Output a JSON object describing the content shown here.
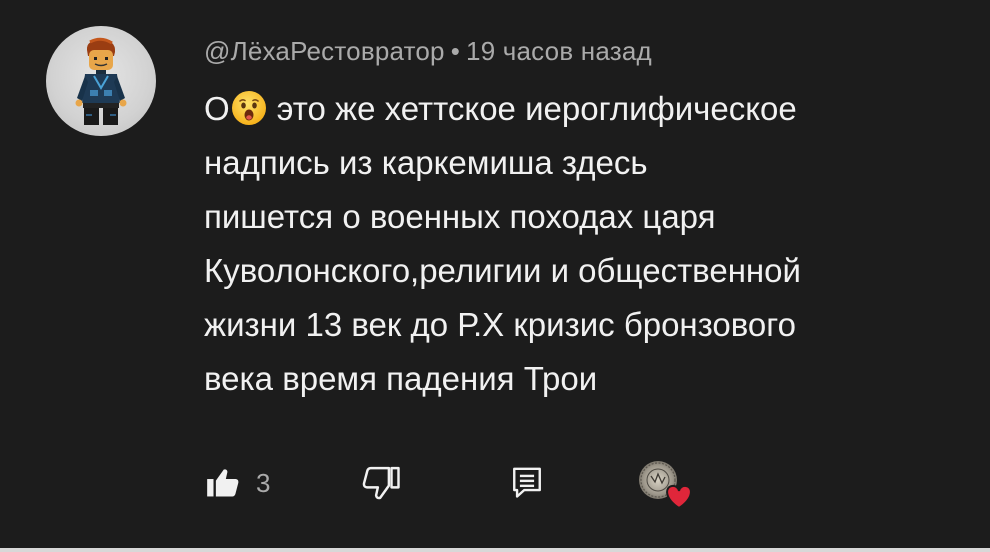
{
  "comment": {
    "author": "@ЛёхаРестовратор",
    "separator": "•",
    "time": "19 часов назад",
    "text_lines": [
      {
        "pre": "О",
        "emoji": "surprised-face",
        "post": "это же хеттское иероглифическое"
      },
      "надпись из каркемиша здесь",
      "пишется о военных походах царя",
      "Куволонского,религии и общественной",
      "жизни 13 век до Р.Х кризис бронзового",
      "века время падения Трои"
    ]
  },
  "actions": {
    "like_count": "3",
    "like_icon": "thumbs-up-icon",
    "dislike_icon": "thumbs-down-icon",
    "reply_icon": "reply-icon",
    "hearted_icon": "creator-heart-icon"
  },
  "colors": {
    "background": "#1c1c1c",
    "text": "#f1f1f1",
    "secondary_text": "#aaaaaa",
    "heart": "#e0263a"
  }
}
